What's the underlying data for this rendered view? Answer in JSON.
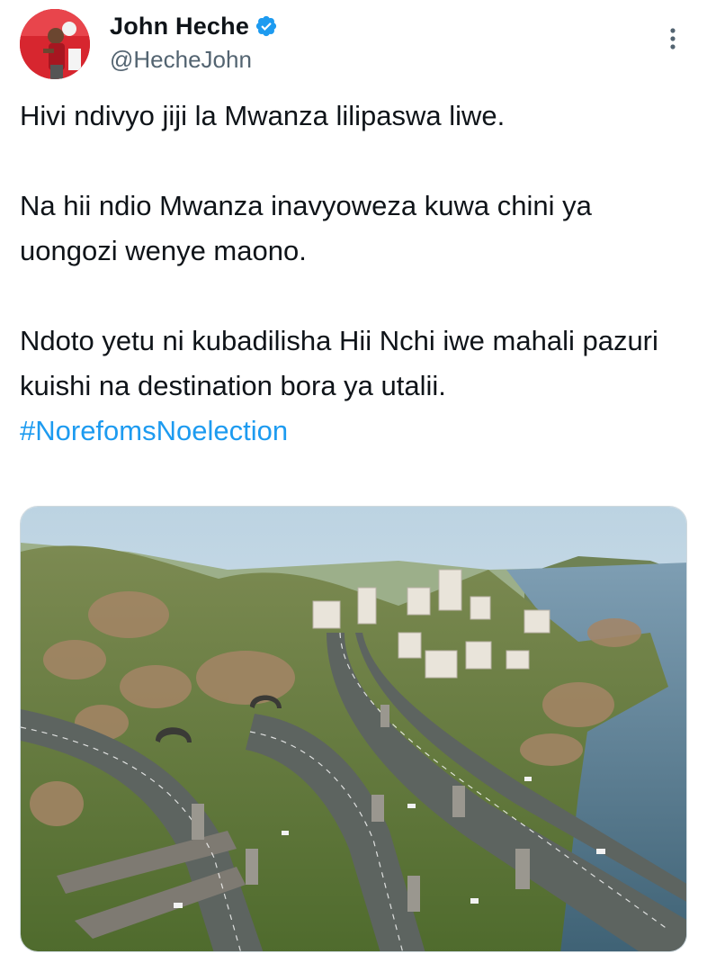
{
  "author": {
    "display_name": "John Heche",
    "handle": "@HecheJohn",
    "verified_icon": "verified-badge-icon",
    "avatar_color": "#c8202c"
  },
  "tweet": {
    "paragraphs": [
      "Hivi ndivyo jiji la Mwanza lilipaswa liwe.",
      "Na hii ndio Mwanza inavyoweza kuwa chini ya uongozi wenye maono.",
      "Ndoto yetu ni kubadilisha Hii Nchi iwe mahali pazuri kuishi na destination bora ya utalii."
    ],
    "hashtag": "#NorefomsNoelection"
  },
  "media": {
    "type": "photo"
  },
  "colors": {
    "link": "#1d9bf0",
    "secondary_text": "#536471",
    "verified": "#1d9bf0"
  }
}
